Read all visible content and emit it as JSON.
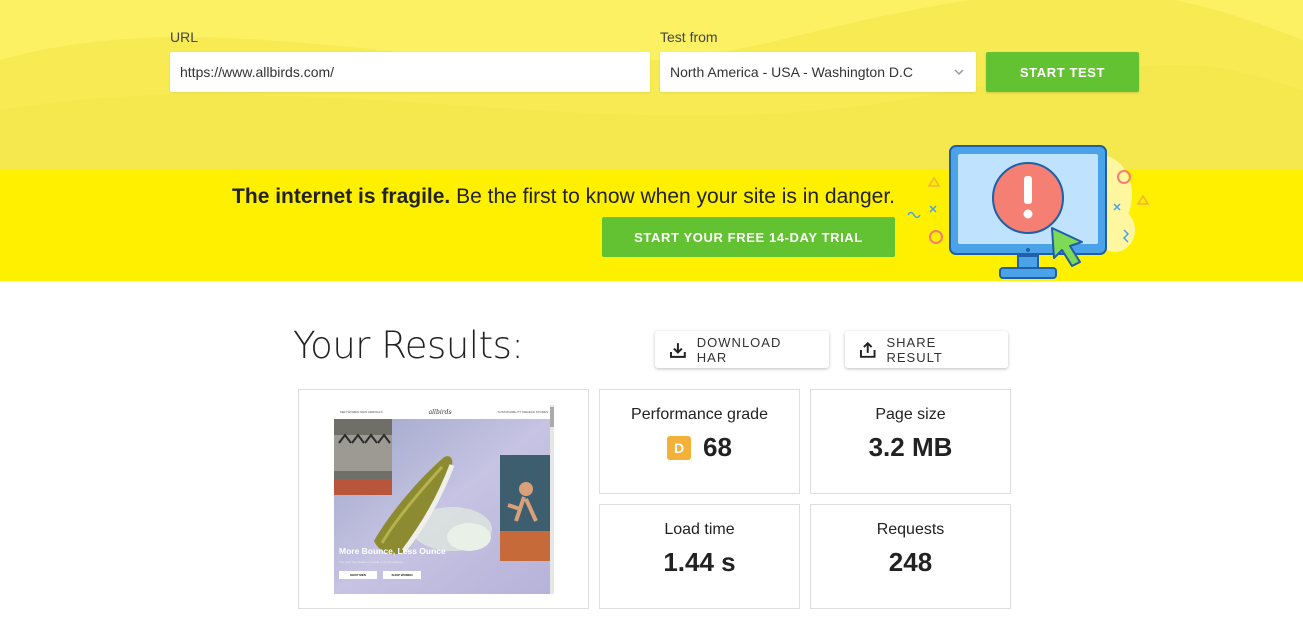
{
  "form": {
    "url_label": "URL",
    "url_value": "https://www.allbirds.com/",
    "test_from_label": "Test from",
    "test_from_value": "North America - USA - Washington D.C",
    "start_test_label": "START TEST"
  },
  "promo": {
    "headline_bold": "The internet is fragile.",
    "headline_rest": " Be the first to know when your site is in danger.",
    "trial_button": "START YOUR FREE 14-DAY TRIAL"
  },
  "results": {
    "title": "Your Results:",
    "download_har_label": "DOWNLOAD HAR",
    "share_result_label": "SHARE RESULT",
    "metrics": {
      "performance_label": "Performance grade",
      "performance_grade": "D",
      "performance_value": "68",
      "page_size_label": "Page size",
      "page_size_value": "3.2 MB",
      "load_time_label": "Load time",
      "load_time_value": "1.44 s",
      "requests_label": "Requests",
      "requests_value": "248"
    }
  },
  "thumbnail": {
    "nav_left": "MEN  WOMEN  NEW ARRIVALS",
    "logo": "allbirds",
    "nav_right": "SUSTAINABILITY  REREAD  STORES",
    "headline": "More Bounce, Less Ounce",
    "subtext": "The new Tree Dasher is made to go the distance",
    "button_men": "SHOP MEN",
    "button_women": "SHOP WOMEN"
  },
  "colors": {
    "top_yellow": "#f7ea52",
    "banner_yellow": "#fff000",
    "green": "#63c232",
    "grade_orange": "#f4b13a"
  }
}
